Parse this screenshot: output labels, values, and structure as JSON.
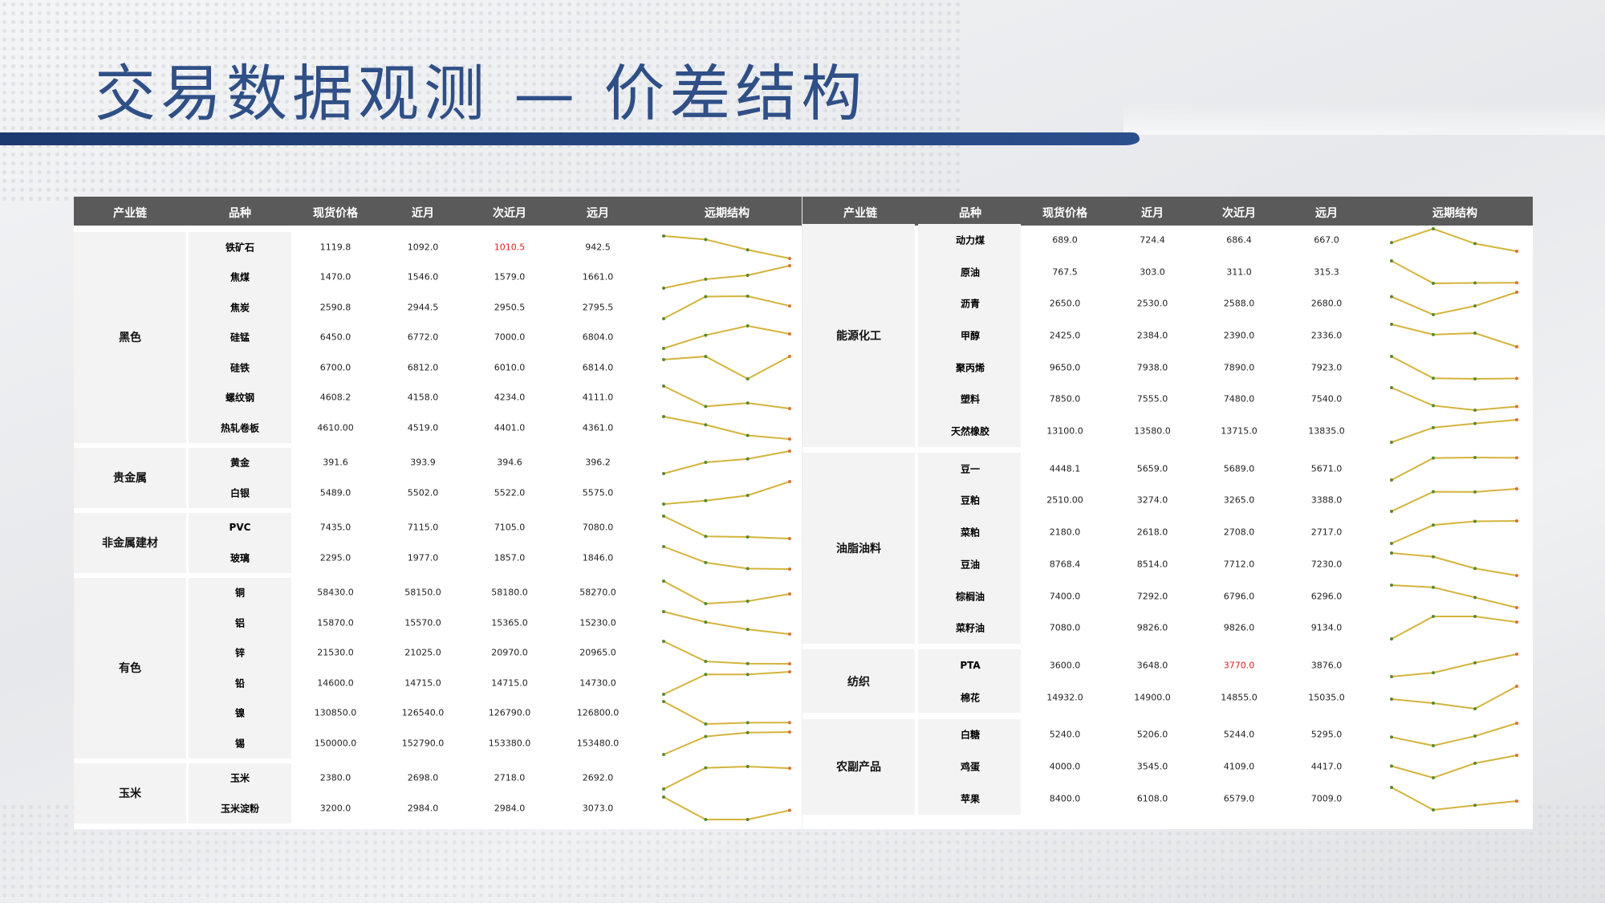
{
  "title": "交易数据观测 — 价差结构",
  "headers": [
    "产业链",
    "品种",
    "现货价格",
    "近月",
    "次近月",
    "远月",
    "远期结构"
  ],
  "colors": {
    "spark_line": "#d4b43c",
    "spark_dot": "#5a8a2a",
    "spark_dot_last": "#e07030",
    "highlight": "#e02020",
    "header_bg": "#5a5a5a"
  },
  "left_groups": [
    {
      "name": "黑色",
      "rows": [
        {
          "variety": "铁矿石",
          "spot": "1119.8",
          "near": "1092.0",
          "next": "1010.5",
          "far": "942.5",
          "hl": "next"
        },
        {
          "variety": "焦煤",
          "spot": "1470.0",
          "near": "1546.0",
          "next": "1579.0",
          "far": "1661.0"
        },
        {
          "variety": "焦炭",
          "spot": "2590.8",
          "near": "2944.5",
          "next": "2950.5",
          "far": "2795.5"
        },
        {
          "variety": "硅锰",
          "spot": "6450.0",
          "near": "6772.0",
          "next": "7000.0",
          "far": "6804.0"
        },
        {
          "variety": "硅铁",
          "spot": "6700.0",
          "near": "6812.0",
          "next": "6010.0",
          "far": "6814.0"
        },
        {
          "variety": "螺纹钢",
          "spot": "4608.2",
          "near": "4158.0",
          "next": "4234.0",
          "far": "4111.0"
        },
        {
          "variety": "热轧卷板",
          "spot": "4610.00",
          "near": "4519.0",
          "next": "4401.0",
          "far": "4361.0"
        }
      ]
    },
    {
      "name": "贵金属",
      "rows": [
        {
          "variety": "黄金",
          "spot": "391.6",
          "near": "393.9",
          "next": "394.6",
          "far": "396.2"
        },
        {
          "variety": "白银",
          "spot": "5489.0",
          "near": "5502.0",
          "next": "5522.0",
          "far": "5575.0"
        }
      ]
    },
    {
      "name": "非金属建材",
      "rows": [
        {
          "variety": "PVC",
          "spot": "7435.0",
          "near": "7115.0",
          "next": "7105.0",
          "far": "7080.0"
        },
        {
          "variety": "玻璃",
          "spot": "2295.0",
          "near": "1977.0",
          "next": "1857.0",
          "far": "1846.0"
        }
      ]
    },
    {
      "name": "有色",
      "rows": [
        {
          "variety": "铜",
          "spot": "58430.0",
          "near": "58150.0",
          "next": "58180.0",
          "far": "58270.0"
        },
        {
          "variety": "铝",
          "spot": "15870.0",
          "near": "15570.0",
          "next": "15365.0",
          "far": "15230.0"
        },
        {
          "variety": "锌",
          "spot": "21530.0",
          "near": "21025.0",
          "next": "20970.0",
          "far": "20965.0"
        },
        {
          "variety": "铅",
          "spot": "14600.0",
          "near": "14715.0",
          "next": "14715.0",
          "far": "14730.0"
        },
        {
          "variety": "镍",
          "spot": "130850.0",
          "near": "126540.0",
          "next": "126790.0",
          "far": "126800.0"
        },
        {
          "variety": "锡",
          "spot": "150000.0",
          "near": "152790.0",
          "next": "153380.0",
          "far": "153480.0"
        }
      ]
    },
    {
      "name": "玉米",
      "rows": [
        {
          "variety": "玉米",
          "spot": "2380.0",
          "near": "2698.0",
          "next": "2718.0",
          "far": "2692.0"
        },
        {
          "variety": "玉米淀粉",
          "spot": "3200.0",
          "near": "2984.0",
          "next": "2984.0",
          "far": "3073.0"
        }
      ]
    }
  ],
  "right_groups": [
    {
      "name": "能源化工",
      "rows": [
        {
          "variety": "动力煤",
          "spot": "689.0",
          "near": "724.4",
          "next": "686.4",
          "far": "667.0"
        },
        {
          "variety": "原油",
          "spot": "767.5",
          "near": "303.0",
          "next": "311.0",
          "far": "315.3"
        },
        {
          "variety": "沥青",
          "spot": "2650.0",
          "near": "2530.0",
          "next": "2588.0",
          "far": "2680.0"
        },
        {
          "variety": "甲醇",
          "spot": "2425.0",
          "near": "2384.0",
          "next": "2390.0",
          "far": "2336.0"
        },
        {
          "variety": "聚丙烯",
          "spot": "9650.0",
          "near": "7938.0",
          "next": "7890.0",
          "far": "7923.0"
        },
        {
          "variety": "塑料",
          "spot": "7850.0",
          "near": "7555.0",
          "next": "7480.0",
          "far": "7540.0"
        },
        {
          "variety": "天然橡胶",
          "spot": "13100.0",
          "near": "13580.0",
          "next": "13715.0",
          "far": "13835.0"
        }
      ]
    },
    {
      "name": "油脂油料",
      "rows": [
        {
          "variety": "豆一",
          "spot": "4448.1",
          "near": "5659.0",
          "next": "5689.0",
          "far": "5671.0"
        },
        {
          "variety": "豆粕",
          "spot": "2510.00",
          "near": "3274.0",
          "next": "3265.0",
          "far": "3388.0"
        },
        {
          "variety": "菜粕",
          "spot": "2180.0",
          "near": "2618.0",
          "next": "2708.0",
          "far": "2717.0"
        },
        {
          "variety": "豆油",
          "spot": "8768.4",
          "near": "8514.0",
          "next": "7712.0",
          "far": "7230.0"
        },
        {
          "variety": "棕榈油",
          "spot": "7400.0",
          "near": "7292.0",
          "next": "6796.0",
          "far": "6296.0"
        },
        {
          "variety": "菜籽油",
          "spot": "7080.0",
          "near": "9826.0",
          "next": "9826.0",
          "far": "9134.0"
        }
      ]
    },
    {
      "name": "纺织",
      "rows": [
        {
          "variety": "PTA",
          "spot": "3600.0",
          "near": "3648.0",
          "next": "3770.0",
          "far": "3876.0",
          "hl": "next"
        },
        {
          "variety": "棉花",
          "spot": "14932.0",
          "near": "14900.0",
          "next": "14855.0",
          "far": "15035.0"
        }
      ]
    },
    {
      "name": "农副产品",
      "rows": [
        {
          "variety": "白糖",
          "spot": "5240.0",
          "near": "5206.0",
          "next": "5244.0",
          "far": "5295.0"
        },
        {
          "variety": "鸡蛋",
          "spot": "4000.0",
          "near": "3545.0",
          "next": "4109.0",
          "far": "4417.0"
        },
        {
          "variety": "苹果",
          "spot": "8400.0",
          "near": "6108.0",
          "next": "6579.0",
          "far": "7009.0"
        }
      ]
    }
  ]
}
